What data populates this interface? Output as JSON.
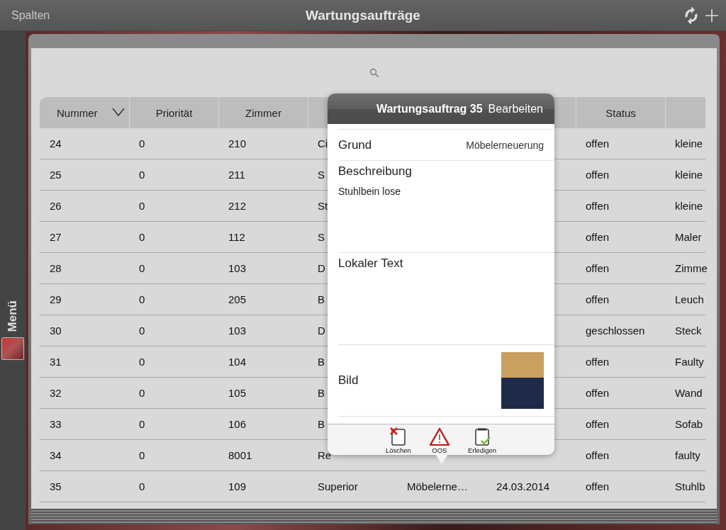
{
  "nav": {
    "left_button": "Spalten",
    "title": "Wartungsaufträge"
  },
  "sidebar": {
    "label": "Menü"
  },
  "table": {
    "columns": [
      {
        "label": "Nummer",
        "sorted": true
      },
      {
        "label": "Priorität",
        "sorted": false
      },
      {
        "label": "Zimmer",
        "sorted": false
      },
      null,
      null,
      null,
      {
        "label": "Status",
        "sorted": false
      },
      null
    ],
    "rows": [
      {
        "cells": [
          "24",
          "0",
          "210",
          "Ci",
          null,
          null,
          "offen",
          "kleine"
        ]
      },
      {
        "cells": [
          "25",
          "0",
          "211",
          "S",
          null,
          null,
          "offen",
          "kleine"
        ]
      },
      {
        "cells": [
          "26",
          "0",
          "212",
          "St",
          null,
          null,
          "offen",
          "kleine"
        ]
      },
      {
        "cells": [
          "27",
          "0",
          "112",
          "S",
          null,
          null,
          "offen",
          "Maler"
        ]
      },
      {
        "cells": [
          "28",
          "0",
          "103",
          "D",
          null,
          null,
          "offen",
          "Zimme"
        ]
      },
      {
        "cells": [
          "29",
          "0",
          "205",
          "B",
          null,
          null,
          "offen",
          "Leuch"
        ]
      },
      {
        "cells": [
          "30",
          "0",
          "103",
          "D",
          null,
          null,
          "geschlossen",
          "Steck"
        ]
      },
      {
        "cells": [
          "31",
          "0",
          "104",
          "B",
          null,
          null,
          "offen",
          "Faulty"
        ]
      },
      {
        "cells": [
          "32",
          "0",
          "105",
          "B",
          null,
          null,
          "offen",
          "Wand"
        ]
      },
      {
        "cells": [
          "33",
          "0",
          "106",
          "B",
          null,
          null,
          "offen",
          "Sofab"
        ]
      },
      {
        "cells": [
          "34",
          "0",
          "8001",
          "Re",
          null,
          null,
          "offen",
          "faulty"
        ]
      },
      {
        "cells": [
          "35",
          "0",
          "109",
          "Superior",
          "Möbelerne…",
          "24.03.2014",
          "offen",
          "Stuhlb"
        ]
      }
    ]
  },
  "popover": {
    "title": "Wartungsauftrag 35",
    "edit_button": "Bearbeiten",
    "fields": [
      {
        "kind": "value",
        "label": "Grund",
        "value": "Möbelerneuerung"
      },
      {
        "kind": "text",
        "label": "Beschreibung",
        "value": "Stuhlbein lose"
      },
      {
        "kind": "text",
        "label": "Lokaler Text"
      },
      {
        "kind": "image",
        "label": "Bild"
      }
    ],
    "actions": [
      {
        "kind": "delete",
        "label": "Löschen"
      },
      {
        "kind": "warning",
        "label": "OOS"
      },
      {
        "kind": "done",
        "label": "Erledigen"
      }
    ]
  }
}
